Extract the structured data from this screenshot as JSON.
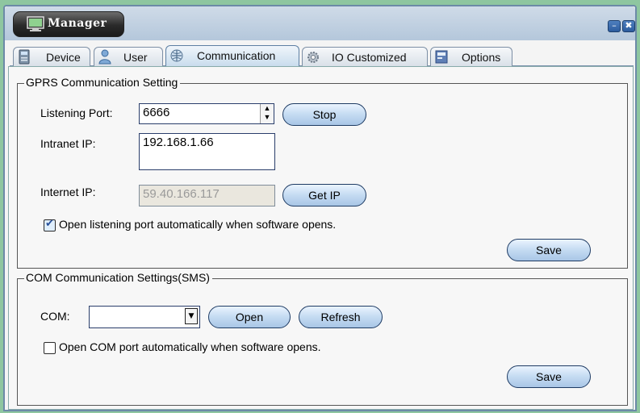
{
  "window": {
    "title": "Manager",
    "controls": {
      "minimize_glyph": "–",
      "close_glyph": "✖"
    }
  },
  "tabs": [
    {
      "label": "Device",
      "icon": "device-icon",
      "active": false
    },
    {
      "label": "User",
      "icon": "user-icon",
      "active": false
    },
    {
      "label": "Communication",
      "icon": "communication-icon",
      "active": true
    },
    {
      "label": "IO Customized",
      "icon": "gear-icon",
      "active": false
    },
    {
      "label": "Options",
      "icon": "options-icon",
      "active": false
    }
  ],
  "gprs": {
    "title": "GPRS Communication Setting",
    "listening_port_label": "Listening Port:",
    "listening_port_value": "6666",
    "stop_button": "Stop",
    "intranet_ip_label": "Intranet IP:",
    "intranet_ip_value": "192.168.1.66",
    "internet_ip_label": "Internet IP:",
    "internet_ip_value": "59.40.166.117",
    "get_ip_button": "Get IP",
    "auto_open_label": "Open listening port automatically when software opens.",
    "auto_open_checked": true,
    "save_button": "Save"
  },
  "com": {
    "title": "COM Communication Settings(SMS)",
    "com_label": "COM:",
    "com_value": "",
    "open_button": "Open",
    "refresh_button": "Refresh",
    "auto_open_label": "Open COM port automatically when software opens.",
    "auto_open_checked": false,
    "save_button": "Save"
  },
  "colors": {
    "accent": "#2c5c9e",
    "button_border": "#1e3b63",
    "disabled_bg": "#eae7de"
  }
}
